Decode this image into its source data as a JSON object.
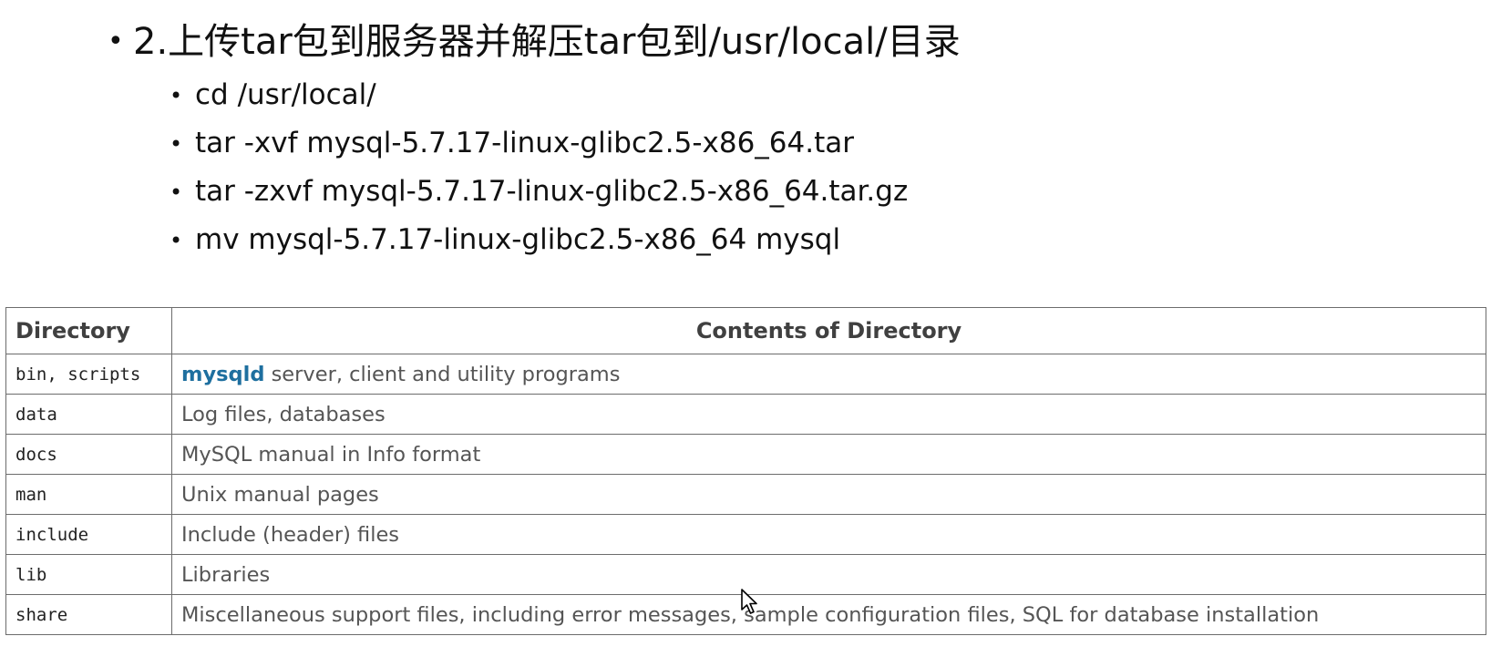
{
  "heading": {
    "bullet": "•",
    "text": "2.上传tar包到服务器并解压tar包到/usr/local/目录"
  },
  "commands": [
    {
      "bullet": "•",
      "text": "cd /usr/local/"
    },
    {
      "bullet": "•",
      "text": "tar -xvf mysql-5.7.17-linux-glibc2.5-x86_64.tar"
    },
    {
      "bullet": "•",
      "text": "tar -zxvf mysql-5.7.17-linux-glibc2.5-x86_64.tar.gz"
    },
    {
      "bullet": "•",
      "text": "mv mysql-5.7.17-linux-glibc2.5-x86_64 mysql"
    }
  ],
  "table": {
    "headers": [
      "Directory",
      "Contents of Directory"
    ],
    "rows": [
      {
        "dir": "bin, scripts",
        "highlight": "mysqld",
        "contents": " server, client and utility programs"
      },
      {
        "dir": "data",
        "highlight": "",
        "contents": "Log files, databases"
      },
      {
        "dir": "docs",
        "highlight": "",
        "contents": "MySQL manual in Info format"
      },
      {
        "dir": "man",
        "highlight": "",
        "contents": "Unix manual pages"
      },
      {
        "dir": "include",
        "highlight": "",
        "contents": "Include (header) files"
      },
      {
        "dir": "lib",
        "highlight": "",
        "contents": "Libraries"
      },
      {
        "dir": "share",
        "highlight": "",
        "contents": "Miscellaneous support files, including error messages, sample configuration files, SQL for database installation"
      }
    ]
  },
  "colors": {
    "highlight": "#1e6f9f",
    "border": "#6c6c6c"
  },
  "icons": {
    "cursor": "mouse-pointer-icon"
  }
}
